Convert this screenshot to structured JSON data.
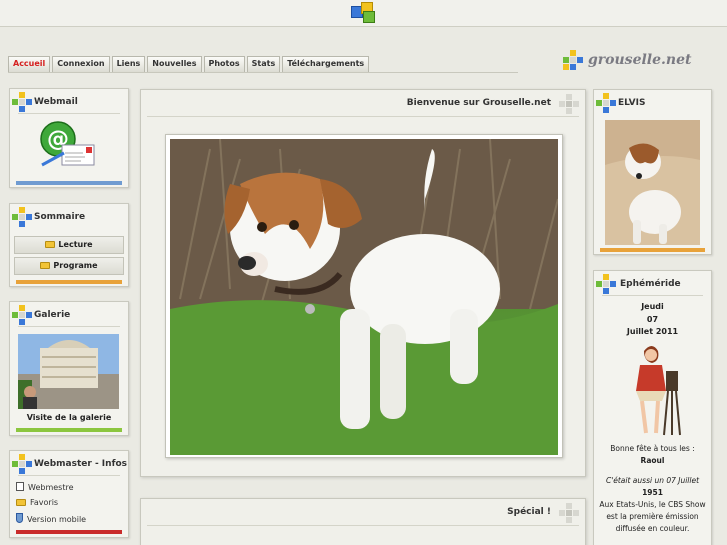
{
  "nav": {
    "tabs": [
      "Accueil",
      "Connexion",
      "Liens",
      "Nouvelles",
      "Photos",
      "Stats",
      "Téléchargements"
    ]
  },
  "brand": {
    "text": "grouselle.net"
  },
  "webmail": {
    "title": "Webmail"
  },
  "sommaire": {
    "title": "Sommaire",
    "items": [
      "Lecture",
      "Programe"
    ]
  },
  "galerie": {
    "title": "Galerie",
    "link": "Visite de la galerie"
  },
  "webmaster": {
    "title": "Webmaster - Infos",
    "items": [
      "Webmestre",
      "Favoris",
      "Version mobile"
    ]
  },
  "main": {
    "title": "Bienvenue sur Grouselle.net"
  },
  "special": {
    "title": "Spécial !"
  },
  "elvis": {
    "title": "ELVIS"
  },
  "ephemeride": {
    "title": "Ephéméride",
    "day": "Jeudi",
    "date": "07",
    "month_year": "Juillet 2011",
    "fete_label": "Bonne fête à tous les :",
    "fete_name": "Raoul",
    "history_intro": "C'était aussi un 07 Juillet",
    "history_year": "1951",
    "history_text_1": "Aux Etats-Unis, le CBS Show",
    "history_text_2": "est la première émission",
    "history_text_3": "diffusée en couleur."
  },
  "colors": {
    "active_tab": "#d52020",
    "bar_blue": "#6f9bd1",
    "bar_orange": "#e8a23a",
    "bar_green": "#8cc63f",
    "bar_red": "#c92b2b"
  }
}
